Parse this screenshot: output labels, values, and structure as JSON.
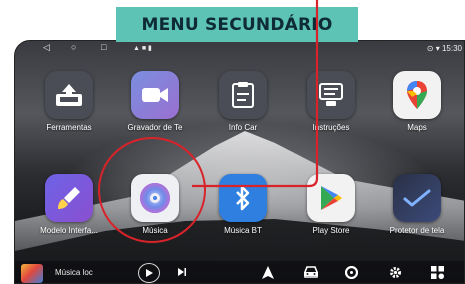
{
  "callout": {
    "label": "MENU SECUNDÁRIO"
  },
  "status_bar": {
    "time": "15:30",
    "icons": [
      "location-icon",
      "wifi-icon"
    ]
  },
  "apps_row1": [
    {
      "label": "Ferramentas",
      "icon": "upload-tray-icon",
      "color": "#4a4d55"
    },
    {
      "label": "Gravador de Te",
      "icon": "video-camera-icon",
      "color": "#6f7cc9"
    },
    {
      "label": "Info Car",
      "icon": "clipboard-icon",
      "color": "#4a4d55"
    },
    {
      "label": "Instruções",
      "icon": "instructions-icon",
      "color": "#4a4d55"
    },
    {
      "label": "Maps",
      "icon": "maps-pin-icon",
      "color": "#f2f2f2"
    }
  ],
  "apps_row2": [
    {
      "label": "Modelo Interfa...",
      "icon": "paint-brush-icon",
      "color": "#5b5fd6"
    },
    {
      "label": "Música",
      "icon": "disc-icon",
      "color": "#eef0f4"
    },
    {
      "label": "Música BT",
      "icon": "bluetooth-icon",
      "color": "#2e7fe0"
    },
    {
      "label": "Play Store",
      "icon": "play-store-icon",
      "color": "#f2f2f2"
    },
    {
      "label": "Protetor de tela",
      "icon": "clock-icon",
      "color": "#2d3650"
    }
  ],
  "dock": {
    "track": "Música loc"
  }
}
